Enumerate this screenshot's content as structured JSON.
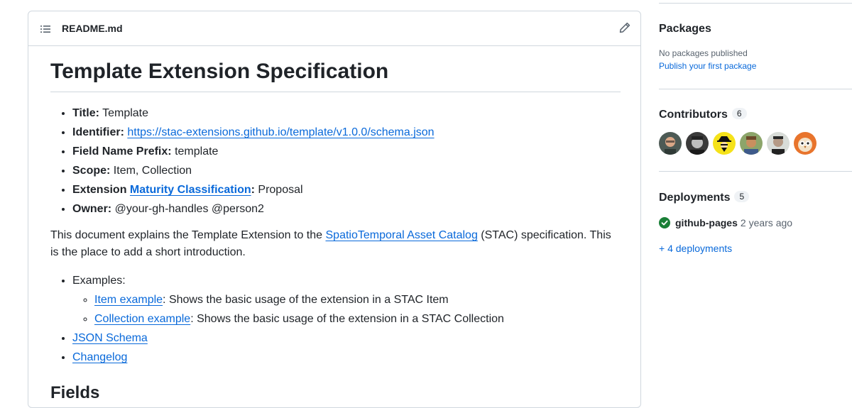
{
  "readme": {
    "filename": "README.md",
    "title": "Template Extension Specification",
    "meta": {
      "title_label": "Title:",
      "title_value": "Template",
      "identifier_label": "Identifier:",
      "identifier_value": "https://stac-extensions.github.io/template/v1.0.0/schema.json",
      "prefix_label": "Field Name Prefix:",
      "prefix_value": "template",
      "scope_label": "Scope:",
      "scope_value": "Item, Collection",
      "extension_label": "Extension",
      "maturity_link": "Maturity Classification",
      "maturity_colon": ":",
      "maturity_value": "Proposal",
      "owner_label": "Owner:",
      "owner_value": "@your-gh-handles @person2"
    },
    "intro": {
      "before": "This document explains the Template Extension to the",
      "link": "SpatioTemporal Asset Catalog",
      "after": "(STAC) specification. This is the place to add a short introduction."
    },
    "links": {
      "examples_label": "Examples:",
      "item_example_link": "Item example",
      "item_example_text": ": Shows the basic usage of the extension in a STAC Item",
      "collection_example_link": "Collection example",
      "collection_example_text": ": Shows the basic usage of the extension in a STAC Collection",
      "json_schema": "JSON Schema",
      "changelog": "Changelog"
    },
    "next_heading": "Fields"
  },
  "sidebar": {
    "packages": {
      "heading": "Packages",
      "empty_text": "No packages published",
      "publish_link": "Publish your first package"
    },
    "contributors": {
      "heading": "Contributors",
      "count": "6",
      "avatars": [
        "avatar-1",
        "avatar-2",
        "avatar-3",
        "avatar-4",
        "avatar-5",
        "avatar-6"
      ]
    },
    "deployments": {
      "heading": "Deployments",
      "count": "5",
      "env_name": "github-pages",
      "env_time": "2 years ago",
      "more_link": "+ 4 deployments",
      "status_color": "#1a7f37"
    }
  },
  "colors": {
    "link": "#0969da",
    "border": "#d0d7de",
    "text": "#1f2328",
    "muted": "#59636e"
  }
}
